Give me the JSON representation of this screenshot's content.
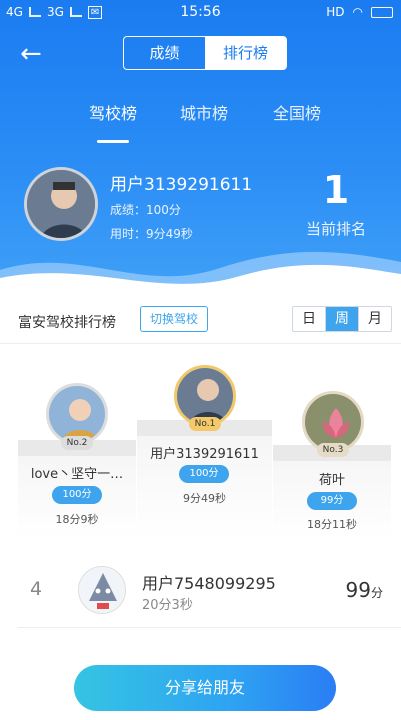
{
  "status": {
    "carrier1": "4G",
    "carrier2": "3G",
    "time": "15:56",
    "hd": "HD"
  },
  "header": {
    "back_icon": "arrow-left-icon",
    "segment": [
      "成绩",
      "排行榜"
    ],
    "segment_selected": "排行榜",
    "tabs": [
      "驾校榜",
      "城市榜",
      "全国榜"
    ],
    "tab_selected": "驾校榜"
  },
  "me": {
    "name": "用户3139291611",
    "score_line": "成绩：100分",
    "time_line": "用时：9分49秒",
    "rank": "1",
    "rank_label": "当前排名"
  },
  "section": {
    "title": "富安驾校排行榜",
    "switch_label": "切换驾校",
    "periods": [
      "日",
      "周",
      "月"
    ],
    "period_selected": "周"
  },
  "podium": {
    "first": {
      "badge": "No.1",
      "name": "用户3139291611",
      "score": "100分",
      "time": "9分49秒"
    },
    "second": {
      "badge": "No.2",
      "name": "love丶坚守一…",
      "score": "100分",
      "time": "18分9秒"
    },
    "third": {
      "badge": "No.3",
      "name": "荷叶",
      "score": "99分",
      "time": "18分11秒"
    }
  },
  "list": [
    {
      "rank": "4",
      "name": "用户7548099295",
      "time": "20分3秒",
      "score": "99",
      "unit": "分"
    }
  ],
  "share_label": "分享给朋友",
  "colors": {
    "primary": "#1a7cf0",
    "accent": "#3ea4ee"
  }
}
